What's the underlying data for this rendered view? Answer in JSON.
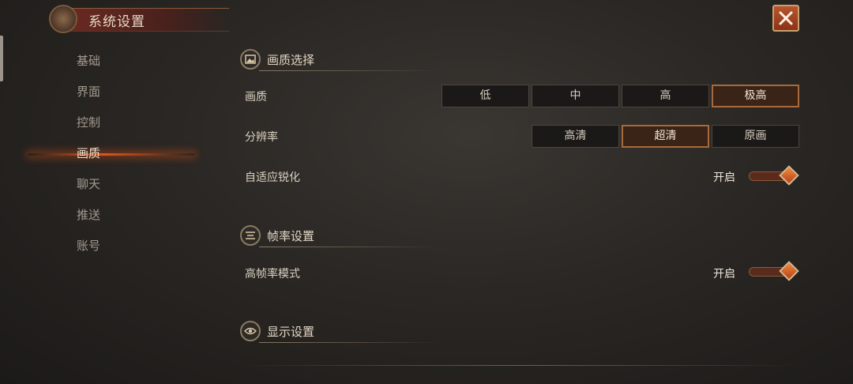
{
  "header": {
    "title": "系统设置"
  },
  "sidebar": {
    "items": [
      {
        "label": "基础",
        "active": false
      },
      {
        "label": "界面",
        "active": false
      },
      {
        "label": "控制",
        "active": false
      },
      {
        "label": "画质",
        "active": true
      },
      {
        "label": "聊天",
        "active": false
      },
      {
        "label": "推送",
        "active": false
      },
      {
        "label": "账号",
        "active": false
      }
    ]
  },
  "sections": {
    "quality": {
      "title": "画质选择",
      "quality_row": {
        "label": "画质",
        "options": [
          "低",
          "中",
          "高",
          "极高"
        ],
        "selected": "极高"
      },
      "resolution_row": {
        "label": "分辨率",
        "options": [
          "高清",
          "超清",
          "原画"
        ],
        "selected": "超清"
      },
      "sharpen_row": {
        "label": "自适应锐化",
        "state_text": "开启"
      }
    },
    "framerate": {
      "title": "帧率设置",
      "high_fps_row": {
        "label": "高帧率模式",
        "state_text": "开启"
      }
    },
    "display": {
      "title": "显示设置"
    }
  },
  "colors": {
    "accent": "#e0561c",
    "selected_border": "#a86a3a",
    "close_button": "#a8482a"
  }
}
